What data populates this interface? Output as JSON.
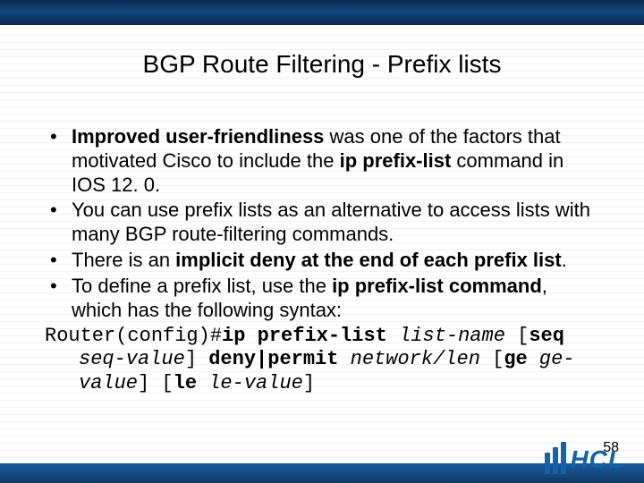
{
  "title": "BGP Route Filtering - Prefix lists",
  "bullets": {
    "b1_pre": "Improved user-friendliness",
    "b1_mid": " was one of the factors that motivated Cisco to include the ",
    "b1_bold2": "ip prefix-list",
    "b1_post": " command in IOS 12. 0.",
    "b2": "You can use prefix lists as an alternative to access lists with many BGP route-filtering commands.",
    "b3_pre": "There is an ",
    "b3_bold": "implicit deny at the end of each prefix list",
    "b3_post": ".",
    "b4_pre": "To define a prefix list, use the ",
    "b4_bold": "ip prefix-list command",
    "b4_post": ", which has the following syntax:"
  },
  "code": {
    "c_router": "Router(config)#",
    "c_cmd": "ip prefix-list",
    "c_sp": " ",
    "c_listname": "list-name",
    "c_lb1": " [",
    "c_seq": "seq",
    "c_seqval": "seq-value",
    "c_rb1": "]",
    "c_denyperm": "deny|permit",
    "c_netlen": "network/len",
    "c_lb2": " [",
    "c_ge": "ge",
    "c_geval": "ge-value",
    "c_rb2": "] [",
    "c_le": "le",
    "c_leval": "le-value",
    "c_rb3": "]"
  },
  "pageNumber": "58",
  "logoText": "HCL"
}
